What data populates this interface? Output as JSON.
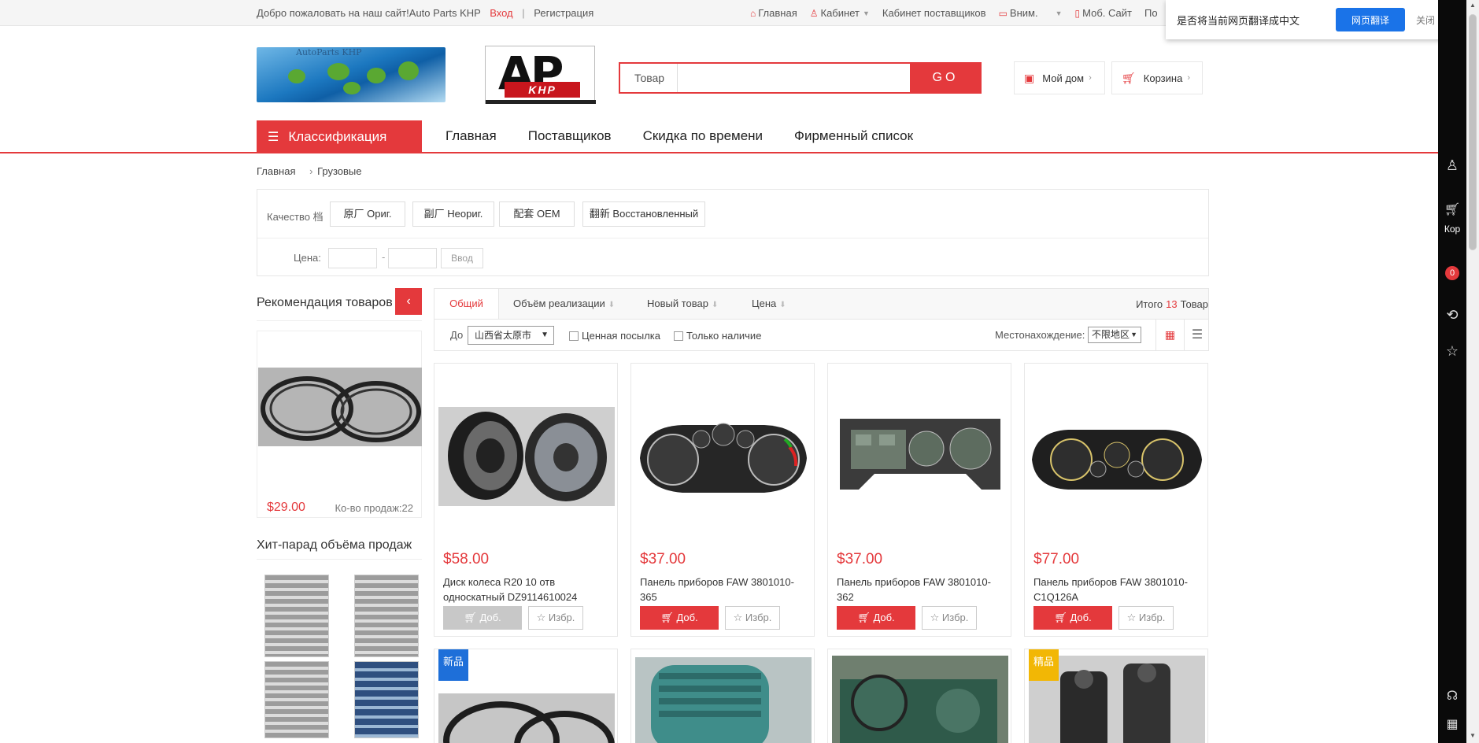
{
  "topbar": {
    "welcome": "Добро пожаловать на наш сайт!Auto Parts KHP",
    "login": "Вход",
    "separator": "|",
    "register": "Регистрация",
    "nav": [
      {
        "label": "Главная",
        "icon": "home-icon"
      },
      {
        "label": "Кабинет",
        "icon": "user-icon"
      },
      {
        "label": "Кабинет поставщиков",
        "icon": ""
      },
      {
        "label": "Вним.",
        "icon": "bookmark-icon"
      },
      {
        "label": "Моб. Сайт",
        "icon": "mobile-icon"
      },
      {
        "label": "По",
        "icon": ""
      }
    ]
  },
  "translate": {
    "message": "是否将当前网页翻译成中文",
    "button": "网页翻译",
    "close": "关闭"
  },
  "logo": {
    "text1": "AutoParts KHP",
    "brand": "AP",
    "brand_sub": "KHP"
  },
  "search": {
    "label": "Товар",
    "button": "GO",
    "value": ""
  },
  "header_buttons": {
    "my_home": "Мой дом",
    "cart": "Корзина"
  },
  "main_nav": {
    "category": "Классификация",
    "links": [
      "Главная",
      "Поставщиков",
      "Скидка по времени",
      "Фирменный список"
    ]
  },
  "breadcrumb": {
    "home": "Главная",
    "current": "Грузовые"
  },
  "filter": {
    "quality_label": "Качество 档",
    "quality_options": [
      "原厂 Ориг.",
      "副厂 Неориг.",
      "配套 OEM",
      "翻新 Восстановленный"
    ],
    "price_label": "Цена:",
    "price_dash": "-",
    "price_button": "Ввод"
  },
  "sidebar": {
    "recommend_title": "Рекомендация товаров",
    "recommend_item": {
      "price": "$29.00",
      "sold": "Ко-во продаж:22"
    },
    "hit_title": "Хит-парад объёма продаж"
  },
  "sort": {
    "tabs": [
      "Общий",
      "Объём реализации",
      "Новый товар",
      "Цена"
    ],
    "total_prefix": "Итого",
    "total_count": "13",
    "total_suffix": "Товар"
  },
  "options": {
    "to_label": "До",
    "region_select": "山西省太原市",
    "checkbox1": "Ценная посылка",
    "checkbox2": "Только наличие",
    "location_label": "Местонахождение:",
    "location_select": "不限地区"
  },
  "products": [
    {
      "price": "$58.00",
      "name": "Диск колеса R20 10 отв односкатный DZ9114610024",
      "add": "Доб.",
      "fav": "Избр.",
      "in_stock": false
    },
    {
      "price": "$37.00",
      "name": "Панель приборов FAW 3801010-365",
      "add": "Доб.",
      "fav": "Избр.",
      "in_stock": true
    },
    {
      "price": "$37.00",
      "name": "Панель приборов FAW 3801010-362",
      "add": "Доб.",
      "fav": "Избр.",
      "in_stock": true
    },
    {
      "price": "$77.00",
      "name": "Панель приборов FAW 3801010-C1Q126A",
      "add": "Доб.",
      "fav": "Избр.",
      "in_stock": true
    }
  ],
  "tags": {
    "new": "新品",
    "best": "精品"
  },
  "right_toolbar": {
    "cart_label": "Кор",
    "cart_count": "0"
  },
  "colors": {
    "accent": "#e4393c",
    "translate_blue": "#1a73e8"
  }
}
